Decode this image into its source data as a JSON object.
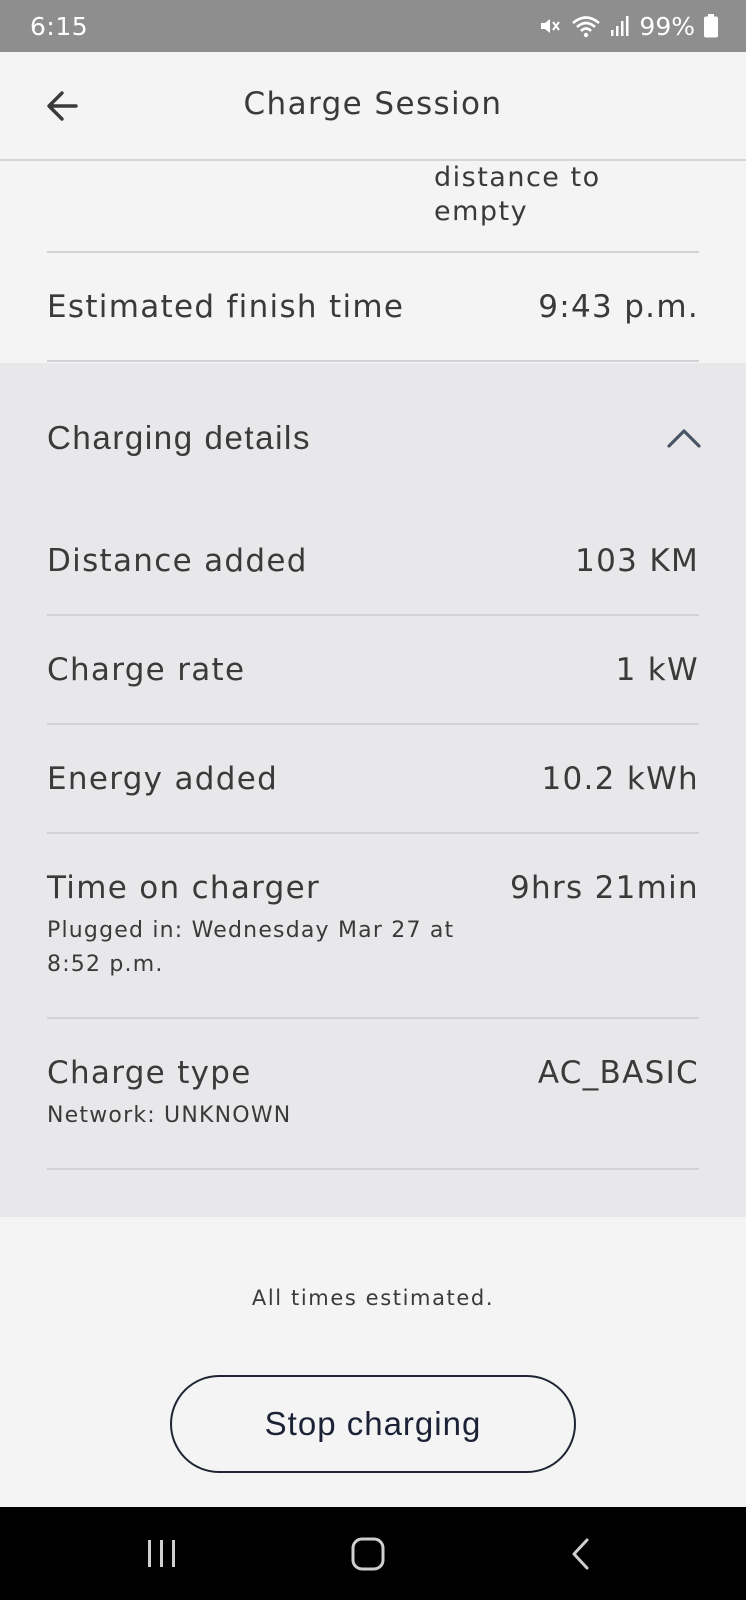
{
  "status_bar": {
    "time": "6:15",
    "battery_text": "99%",
    "icons": [
      "mute-icon",
      "wifi-icon",
      "signal-icon",
      "battery-icon"
    ]
  },
  "header": {
    "title": "Charge Session",
    "back_icon": "arrow-left-icon"
  },
  "partial_above": {
    "line1": "distance to",
    "line2": "empty"
  },
  "finish_time": {
    "label": "Estimated finish time",
    "value": "9:43 p.m."
  },
  "charging_details": {
    "title": "Charging details",
    "toggle_icon": "chevron-up-icon",
    "expanded": true,
    "rows": [
      {
        "label": "Distance added",
        "value": "103 KM"
      },
      {
        "label": "Charge rate",
        "value": "1 kW"
      },
      {
        "label": "Energy added",
        "value": "10.2 kWh"
      },
      {
        "label": "Time on charger",
        "value": "9hrs 21min",
        "sub": "Plugged in: Wednesday Mar 27 at 8:52 p.m."
      },
      {
        "label": "Charge type",
        "value": "AC_BASIC",
        "sub": "Network: UNKNOWN"
      }
    ]
  },
  "footnote": "All times estimated.",
  "stop_button": {
    "label": "Stop charging"
  },
  "nav_bar": {
    "buttons": [
      "recent-apps-icon",
      "home-icon",
      "back-icon"
    ]
  },
  "colors": {
    "status_bar_bg": "#8e8e8e",
    "page_bg": "#f4f4f4",
    "details_bg": "#e8e8ea",
    "text": "#3a3a3a",
    "button_border": "#1e2433",
    "nav_bar_bg": "#000000"
  }
}
